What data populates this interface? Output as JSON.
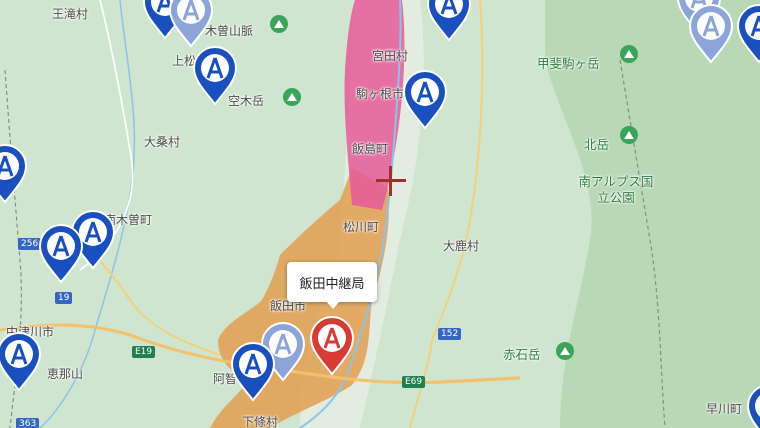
{
  "map": {
    "labels": {
      "ootaki": "王滝村",
      "kiso_sanmyaku": "木曽山脈",
      "agematsu": "上松",
      "utsugidake": "空木岳",
      "miyada": "宮田村",
      "komagane": "駒ヶ根市",
      "iijima": "飯島町",
      "okuwa": "大桑村",
      "matsukawa": "松川町",
      "nagiso": "南木曽町",
      "oshika": "大鹿村",
      "kaikomagatake": "甲斐駒ヶ岳",
      "kitadake": "北岳",
      "minami_alps": "南アルプス国立公園",
      "akaishidake": "赤石岳",
      "nakatsugawa": "中津川市",
      "enasan": "恵那山",
      "iida": "飯田市",
      "achi": "阿智",
      "shimojo": "下條村",
      "hayakawa": "早川町"
    },
    "roads": {
      "r256": "256",
      "r19": "19",
      "e19": "E19",
      "r152": "152",
      "e69": "E69",
      "r363": "363"
    },
    "popup": {
      "title": "飯田中継局"
    },
    "colors": {
      "pin_blue": "#1a4fbf",
      "pin_selected": "#d83a34",
      "coverage_pink": "#e55a98",
      "coverage_orange": "#e39b4a",
      "park": "#b5d7b2",
      "water": "#8cc4e8"
    }
  }
}
